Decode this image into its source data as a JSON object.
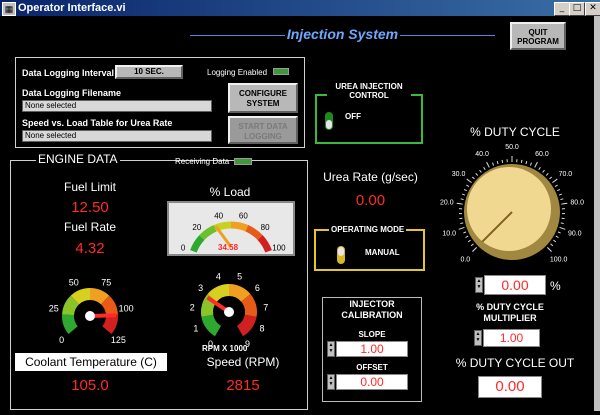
{
  "window": {
    "title": "Operator Interface.vi",
    "min_glyph": "_",
    "max_glyph": "□",
    "close_glyph": "✕"
  },
  "header": {
    "title": "Injection System",
    "quit_label": "QUIT PROGRAM"
  },
  "logging": {
    "interval_label": "Data Logging Interval",
    "interval_value": "10 SEC.",
    "enabled_label": "Logging Enabled",
    "filename_label": "Data Logging Filename",
    "filename_value": "None selected",
    "table_label": "Speed vs. Load Table for Urea Rate",
    "table_value": "None selected",
    "configure_label": "CONFIGURE SYSTEM",
    "start_label": "START DATA LOGGING"
  },
  "engine": {
    "title": "ENGINE DATA",
    "receiving_label": "Receiving Data",
    "fuel_limit_label": "Fuel Limit",
    "fuel_limit_value": "12.50",
    "fuel_rate_label": "Fuel Rate",
    "fuel_rate_value": "4.32",
    "load_label": "% Load",
    "load_value": "34.58",
    "load_ticks": [
      "0",
      "20",
      "40",
      "60",
      "80",
      "100"
    ],
    "load_fraction": 0.3458,
    "coolant_label": "Coolant Temperature (C)",
    "coolant_value": "105.0",
    "coolant_ticks": [
      "0",
      "25",
      "50",
      "75",
      "100",
      "125"
    ],
    "speed_label": "Speed (RPM)",
    "speed_value": "2815",
    "speed_ticks": [
      "0",
      "1",
      "2",
      "3",
      "4",
      "5",
      "6",
      "7",
      "8",
      "9"
    ],
    "speed_unit": "RPM X 1000"
  },
  "urea": {
    "control_title": "UREA INJECTION CONTROL",
    "control_state": "OFF",
    "rate_label": "Urea Rate (g/sec)",
    "rate_value": "0.00",
    "mode_title": "OPERATING MODE",
    "mode_state": "MANUAL"
  },
  "calibration": {
    "title": "INJECTOR CALIBRATION",
    "slope_label": "SLOPE",
    "slope_value": "1.00",
    "offset_label": "OFFSET",
    "offset_value": "0.00"
  },
  "duty": {
    "title": "% DUTY CYCLE",
    "ticks": [
      "0.0",
      "10.0",
      "20.0",
      "30.0",
      "40.0",
      "50.0",
      "60.0",
      "70.0",
      "80.0",
      "90.0",
      "100.0"
    ],
    "value": "0.00",
    "percent": "%",
    "multiplier_label": "% DUTY CYCLE MULTIPLIER",
    "multiplier_value": "1.00",
    "out_label": "% DUTY CYCLE OUT",
    "out_value": "0.00"
  }
}
